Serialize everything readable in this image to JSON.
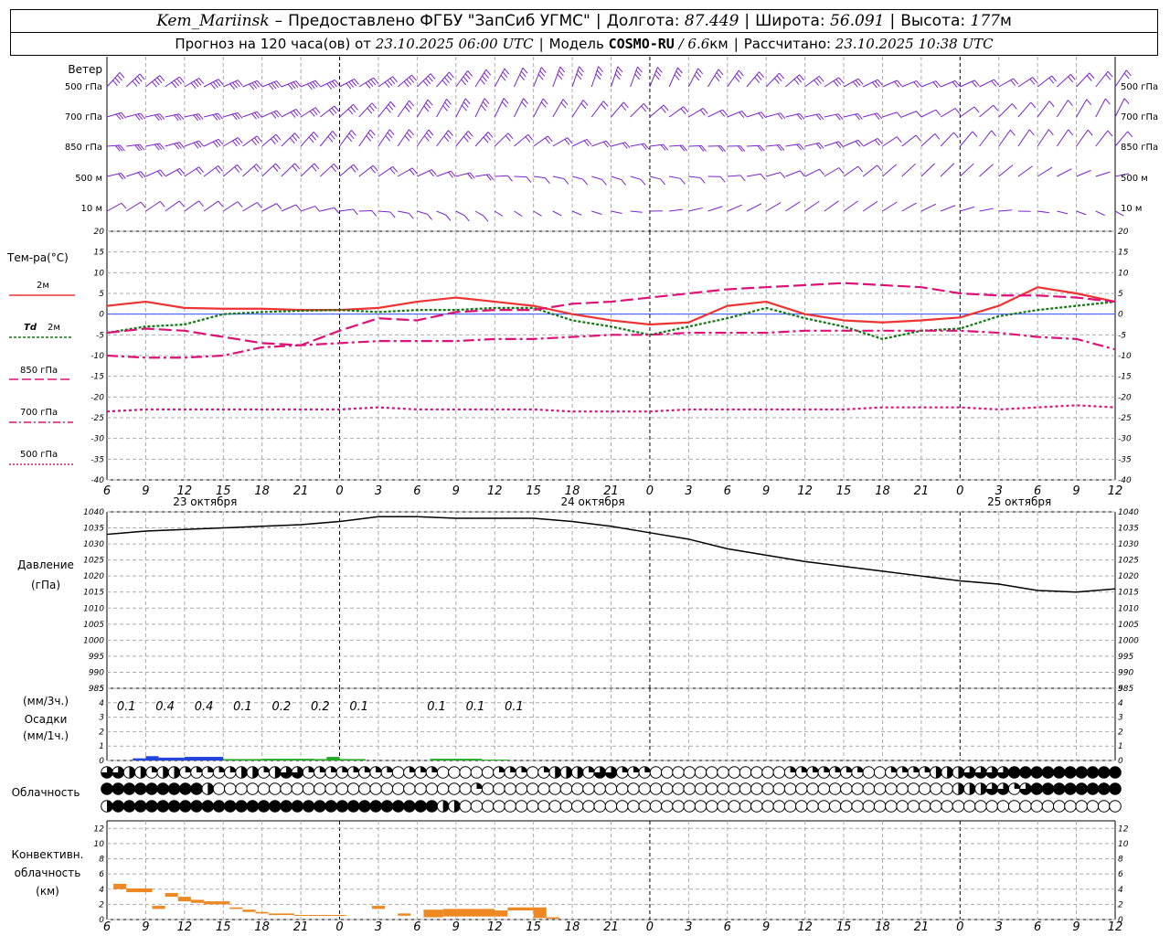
{
  "header": {
    "station": "Kem_Mariinsk",
    "dash": "–",
    "provider": "Предоставлено ФГБУ \"ЗапСиб УГМС\"",
    "lon_label": "Долгота:",
    "lon_value": "87.449",
    "lat_label": "Широта:",
    "lat_value": "56.091",
    "alt_label": "Высота:",
    "alt_value": "177",
    "alt_unit": "м",
    "forecast_label": "Прогноз на 120 часа(ов) от",
    "forecast_start": "23.10.2025 06:00 UTC",
    "model_label": "Модель",
    "model_name": "COSMO-RU",
    "model_res": "/ 6.6",
    "model_res_unit": "км",
    "calc_label": "Рассчитано:",
    "calc_time": "23.10.2025 10:38 UTC"
  },
  "colors": {
    "temp_2m": "#ee3333",
    "td_2m": "#117711",
    "t850": "#dd1177",
    "t700": "#dd1177",
    "t500": "#dd1177",
    "wind": "#7b22cc",
    "pressure": "#000000",
    "precip_blue": "#2244dd",
    "precip_green": "#22aa22",
    "convective": "#ee8822",
    "zero_line": "#3355ff"
  },
  "time_axis": {
    "hours": [
      "6",
      "9",
      "12",
      "15",
      "18",
      "21",
      "0",
      "3",
      "6",
      "9",
      "12",
      "15",
      "18",
      "21",
      "0",
      "3",
      "6",
      "9",
      "12",
      "15",
      "18",
      "21",
      "0",
      "3",
      "6",
      "9",
      "12"
    ],
    "days": [
      "23 октября",
      "24 октября",
      "25 октября"
    ]
  },
  "wind_panel": {
    "title": "Ветер",
    "levels": [
      "500 гПа",
      "700 гПа",
      "850 гПа",
      "500 м",
      "10 м"
    ]
  },
  "temp_panel": {
    "title": "Тем-ра(°C)",
    "legend": [
      {
        "key": "t2m",
        "label": "2м"
      },
      {
        "key": "td2m",
        "prefix": "Td",
        "label": "2м"
      },
      {
        "key": "t850",
        "label": "850 гПа"
      },
      {
        "key": "t700",
        "label": "700 гПа"
      },
      {
        "key": "t500",
        "label": "500 гПа"
      }
    ]
  },
  "pressure_panel": {
    "title": "Давление",
    "unit": "(гПа)"
  },
  "precip_panel": {
    "unit3": "(мм/3ч.)",
    "title": "Осадки",
    "unit1": "(мм/1ч.)"
  },
  "cloud_panel": {
    "title": "Облачность"
  },
  "conv_panel": {
    "title1": "Конвективн.",
    "title2": "облачность",
    "unit": "(км)"
  },
  "chart_data": [
    {
      "type": "line",
      "name": "temperature",
      "x_hours": [
        0,
        3,
        6,
        9,
        12,
        15,
        18,
        21,
        24,
        27,
        30,
        33,
        36,
        39,
        42,
        45,
        48,
        51,
        54,
        57,
        60,
        63,
        66,
        69,
        72,
        75,
        78
      ],
      "ylim": [
        -40,
        20
      ],
      "yticks": [
        20,
        15,
        10,
        5,
        0,
        -5,
        -10,
        -15,
        -20,
        -25,
        -30,
        -35,
        -40
      ],
      "series": [
        {
          "name": "t2m",
          "values": [
            2,
            3,
            1.5,
            1.3,
            1.3,
            1,
            1,
            1.5,
            3,
            4,
            3,
            2,
            0,
            -1.5,
            -2.5,
            -2,
            2,
            3,
            0,
            -1.5,
            -2,
            -1.5,
            -0.8,
            2,
            6.5,
            5,
            3
          ]
        },
        {
          "name": "td2m",
          "values": [
            -4.5,
            -3,
            -2.5,
            0,
            0.5,
            0.8,
            1,
            0.5,
            1,
            1,
            1.5,
            1.5,
            -1.5,
            -3,
            -5,
            -3,
            -1,
            1.5,
            -1,
            -3,
            -6,
            -4,
            -3.5,
            -0.5,
            1,
            2,
            3
          ]
        },
        {
          "name": "t850",
          "values": [
            -4.5,
            -3.5,
            -4,
            -5.5,
            -7,
            -7.5,
            -4,
            -1,
            -1.5,
            0.5,
            1,
            1,
            2.5,
            3,
            4,
            5,
            6,
            6.5,
            7,
            7.5,
            7,
            6.5,
            5,
            4.5,
            4.5,
            4,
            3
          ]
        },
        {
          "name": "t700",
          "values": [
            -10,
            -10.5,
            -10.5,
            -10,
            -8,
            -7.5,
            -7,
            -6.5,
            -6.5,
            -6.5,
            -6,
            -6,
            -5.5,
            -5,
            -5,
            -4.5,
            -4.5,
            -4.5,
            -4,
            -4,
            -4,
            -4,
            -4,
            -4.5,
            -5.5,
            -6,
            -8.5
          ]
        },
        {
          "name": "t500",
          "values": [
            -23.5,
            -23,
            -23,
            -23,
            -23,
            -23,
            -23,
            -22.5,
            -23,
            -23,
            -23,
            -23,
            -23.5,
            -23.5,
            -23.5,
            -23,
            -23,
            -23,
            -23,
            -23,
            -22.5,
            -22.5,
            -22.5,
            -23,
            -22.5,
            -22,
            -22.5
          ]
        }
      ]
    },
    {
      "type": "line",
      "name": "pressure",
      "x_hours": [
        0,
        3,
        6,
        9,
        12,
        15,
        18,
        21,
        24,
        27,
        30,
        33,
        36,
        39,
        42,
        45,
        48,
        51,
        54,
        57,
        60,
        63,
        66,
        69,
        72,
        75,
        78
      ],
      "ylim": [
        985,
        1040
      ],
      "yticks": [
        1040,
        1035,
        1030,
        1025,
        1020,
        1015,
        1010,
        1005,
        1000,
        995,
        990,
        985
      ],
      "values": [
        1033,
        1034,
        1034.5,
        1035,
        1035.5,
        1036,
        1037,
        1038.5,
        1038.5,
        1038,
        1038,
        1038,
        1037,
        1035.5,
        1033.5,
        1031.5,
        1028.5,
        1026.5,
        1024.5,
        1023,
        1021.5,
        1020,
        1018.5,
        1017.5,
        1015.5,
        1015,
        1016
      ]
    },
    {
      "type": "bar",
      "name": "precipitation",
      "ylim": [
        0,
        5
      ],
      "yticks": [
        0,
        1,
        2,
        3,
        4,
        5
      ],
      "labels": [
        {
          "x": 1.5,
          "text": "0.1"
        },
        {
          "x": 4.5,
          "text": "0.4"
        },
        {
          "x": 7.5,
          "text": "0.4"
        },
        {
          "x": 10.5,
          "text": "0.1"
        },
        {
          "x": 13.5,
          "text": "0.2"
        },
        {
          "x": 16.5,
          "text": "0.2"
        },
        {
          "x": 19.5,
          "text": "0.1"
        },
        {
          "x": 25.5,
          "text": "0.1"
        },
        {
          "x": 28.5,
          "text": "0.1"
        },
        {
          "x": 31.5,
          "text": "0.1"
        }
      ],
      "bars": [
        {
          "x0": 2,
          "x1": 3,
          "v": 0.15,
          "c": "b"
        },
        {
          "x0": 3,
          "x1": 4,
          "v": 0.3,
          "c": "b"
        },
        {
          "x0": 4,
          "x1": 6,
          "v": 0.2,
          "c": "b"
        },
        {
          "x0": 6,
          "x1": 9,
          "v": 0.25,
          "c": "b"
        },
        {
          "x0": 9,
          "x1": 12,
          "v": 0.1,
          "c": "g"
        },
        {
          "x0": 12,
          "x1": 16,
          "v": 0.12,
          "c": "g"
        },
        {
          "x0": 16,
          "x1": 17,
          "v": 0.1,
          "c": "g"
        },
        {
          "x0": 17,
          "x1": 18,
          "v": 0.25,
          "c": "g"
        },
        {
          "x0": 18,
          "x1": 20,
          "v": 0.1,
          "c": "g"
        },
        {
          "x0": 25,
          "x1": 29,
          "v": 0.12,
          "c": "g"
        },
        {
          "x0": 29,
          "x1": 31,
          "v": 0.06,
          "c": "g"
        }
      ]
    },
    {
      "type": "bar",
      "name": "convective_clouds",
      "ylim": [
        0,
        13
      ],
      "yticks": [
        0,
        2,
        4,
        6,
        8,
        10,
        12
      ],
      "bars": [
        {
          "x0": 0.5,
          "x1": 1.5,
          "lo": 4,
          "hi": 4.7
        },
        {
          "x0": 1.5,
          "x1": 3.5,
          "lo": 3.6,
          "hi": 4.1
        },
        {
          "x0": 3.5,
          "x1": 4.5,
          "lo": 1.4,
          "hi": 1.8
        },
        {
          "x0": 4.5,
          "x1": 5.5,
          "lo": 3,
          "hi": 3.5
        },
        {
          "x0": 5.5,
          "x1": 6.5,
          "lo": 2.4,
          "hi": 3
        },
        {
          "x0": 6.5,
          "x1": 7.5,
          "lo": 2.2,
          "hi": 2.6
        },
        {
          "x0": 7.5,
          "x1": 9.5,
          "lo": 2,
          "hi": 2.4
        },
        {
          "x0": 9.5,
          "x1": 10.5,
          "lo": 1.4,
          "hi": 1.6
        },
        {
          "x0": 10.5,
          "x1": 11.5,
          "lo": 1,
          "hi": 1.3
        },
        {
          "x0": 11.5,
          "x1": 12.5,
          "lo": 0.8,
          "hi": 1
        },
        {
          "x0": 12.5,
          "x1": 14.5,
          "lo": 0.6,
          "hi": 0.8
        },
        {
          "x0": 14.5,
          "x1": 18.5,
          "lo": 0.5,
          "hi": 0.6
        },
        {
          "x0": 20.5,
          "x1": 21.5,
          "lo": 1.4,
          "hi": 1.8
        },
        {
          "x0": 22.5,
          "x1": 23.5,
          "lo": 0.5,
          "hi": 0.8
        },
        {
          "x0": 24.5,
          "x1": 26,
          "lo": 0.3,
          "hi": 1.3
        },
        {
          "x0": 26,
          "x1": 30,
          "lo": 0.4,
          "hi": 1.4
        },
        {
          "x0": 30,
          "x1": 31,
          "lo": 0.4,
          "hi": 1.2
        },
        {
          "x0": 31,
          "x1": 33,
          "lo": 1.2,
          "hi": 1.6
        },
        {
          "x0": 33,
          "x1": 34,
          "lo": 0.2,
          "hi": 1.6
        },
        {
          "x0": 34,
          "x1": 35,
          "lo": 0.1,
          "hi": 0.3
        }
      ]
    },
    {
      "type": "table",
      "name": "cloudiness",
      "rows": [
        "3322122111112212331111111101110000011101222133111000000000000111111100111122233334444444444",
        "4444444442000000000000000000000001000000000000000000000000000000000000000000222331344444444",
        "2444444444444444444444444444442200000000000000000000000000000000000000000000000000000000000"
      ]
    }
  ]
}
